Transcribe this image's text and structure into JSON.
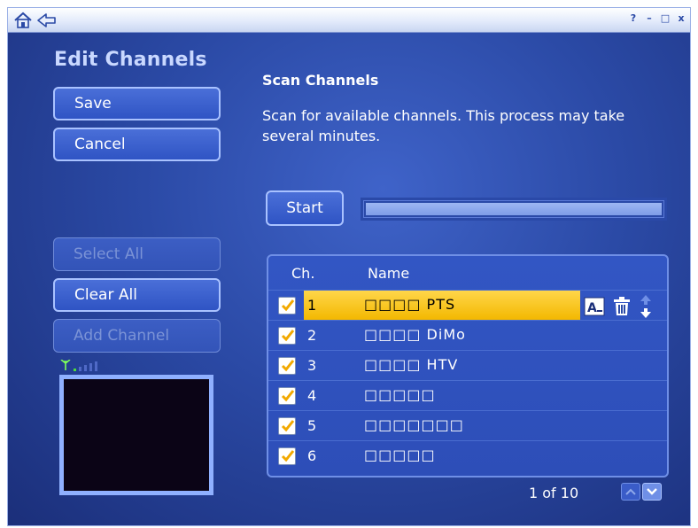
{
  "window": {
    "controls": {
      "help": "?",
      "minimize": "–",
      "maximize": "□",
      "close": "x"
    }
  },
  "page": {
    "title": "Edit Channels"
  },
  "sidebar": {
    "save_label": "Save",
    "cancel_label": "Cancel",
    "select_all_label": "Select All",
    "clear_all_label": "Clear All",
    "add_channel_label": "Add Channel"
  },
  "scan": {
    "title": "Scan Channels",
    "description": "Scan for available channels. This process may take several minutes.",
    "start_label": "Start",
    "progress": 0
  },
  "list": {
    "headers": {
      "channel": "Ch.",
      "name": "Name"
    },
    "rows": [
      {
        "number": "1",
        "name": "□□□□ PTS",
        "checked": true,
        "selected": true
      },
      {
        "number": "2",
        "name": "□□□□ DiMo",
        "checked": true,
        "selected": false
      },
      {
        "number": "3",
        "name": "□□□□ HTV",
        "checked": true,
        "selected": false
      },
      {
        "number": "4",
        "name": "□□□□□",
        "checked": true,
        "selected": false
      },
      {
        "number": "5",
        "name": "□□□□□□□",
        "checked": true,
        "selected": false
      },
      {
        "number": "6",
        "name": "□□□□□",
        "checked": true,
        "selected": false
      }
    ],
    "page_info": "1 of 10"
  },
  "icons": {
    "home": "home-icon",
    "back": "back-arrow-icon",
    "rename": "rename-icon",
    "delete": "trash-icon",
    "move": "move-up-down-icon",
    "signal": "signal-strength-icon"
  },
  "colors": {
    "background": "#2b4aa6",
    "highlight": "#ffd64a",
    "button_border": "#a9c2ff"
  }
}
